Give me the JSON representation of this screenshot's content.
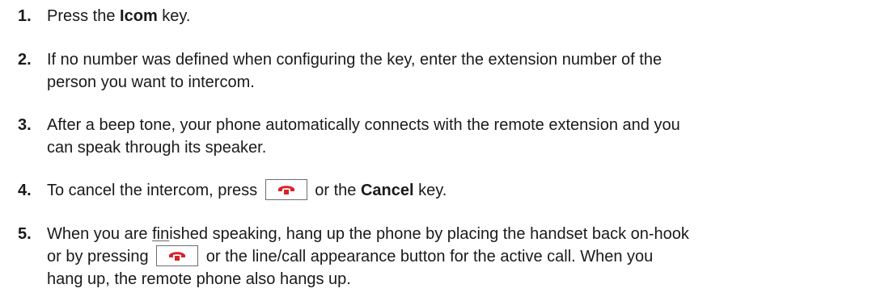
{
  "steps": [
    {
      "number": "1.",
      "before": "Press the ",
      "bold": "Icom",
      "after": " key."
    },
    {
      "number": "2.",
      "line1": "If no number was defined when configuring the key, enter the extension number of the",
      "line2": "person you want to intercom."
    },
    {
      "number": "3.",
      "line1": "After a beep tone, your phone automatically connects with the remote extension and you",
      "line2": "can speak through its speaker."
    },
    {
      "number": "4.",
      "before": "To cancel the intercom, press",
      "middle": "or the ",
      "bold": "Cancel",
      "after": " key."
    },
    {
      "number": "5.",
      "line1_before": "When you are ",
      "line1_underlined": "fin",
      "line1_after": "ished speaking, hang up the phone by placing the handset back on-hook",
      "line2_before": "or by pressing",
      "line2_after": "or the line/call appearance button for the active call. When you",
      "line3": "hang up, the remote phone also hangs up."
    }
  ],
  "icons": {
    "end_call_key": "hang-up-handset-icon",
    "end_call_color": "#d8232a"
  }
}
